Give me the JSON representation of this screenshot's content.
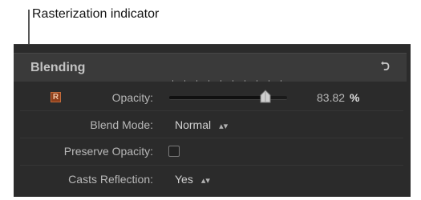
{
  "callout": {
    "text": "Rasterization indicator"
  },
  "section": {
    "title": "Blending",
    "reset_icon": "reset-arrow-icon"
  },
  "rasterization_badge": "R",
  "rows": {
    "opacity": {
      "label": "Opacity:",
      "value": "83.82",
      "unit": "%",
      "fraction": 0.8382
    },
    "blend_mode": {
      "label": "Blend Mode:",
      "value": "Normal"
    },
    "preserve_opacity": {
      "label": "Preserve Opacity:",
      "checked": false
    },
    "casts_reflection": {
      "label": "Casts Reflection:",
      "value": "Yes"
    }
  }
}
